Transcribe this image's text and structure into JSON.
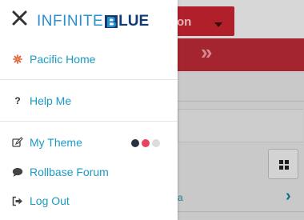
{
  "background": {
    "app_button_label": "on",
    "link_fragment": "a"
  },
  "drawer": {
    "logo": {
      "part1": "INFINITE",
      "part2": "LUE"
    },
    "items": [
      {
        "label": "Pacific Home",
        "icon": "pacific-flower-icon"
      },
      {
        "label": "Help Me",
        "icon": "question-icon"
      },
      {
        "label": "My Theme",
        "icon": "edit-icon"
      },
      {
        "label": "Rollbase Forum",
        "icon": "chat-bubble-icon"
      },
      {
        "label": "Log Out",
        "icon": "sign-out-icon"
      }
    ],
    "theme_colors": [
      "#2b3145",
      "#e8435a",
      "#dcdcdc"
    ]
  },
  "colors": {
    "accent_link": "#1a9bc4",
    "brand_red": "#b01f2a",
    "logo_blue_light": "#2b8fd0",
    "logo_blue_dark": "#123a73"
  }
}
